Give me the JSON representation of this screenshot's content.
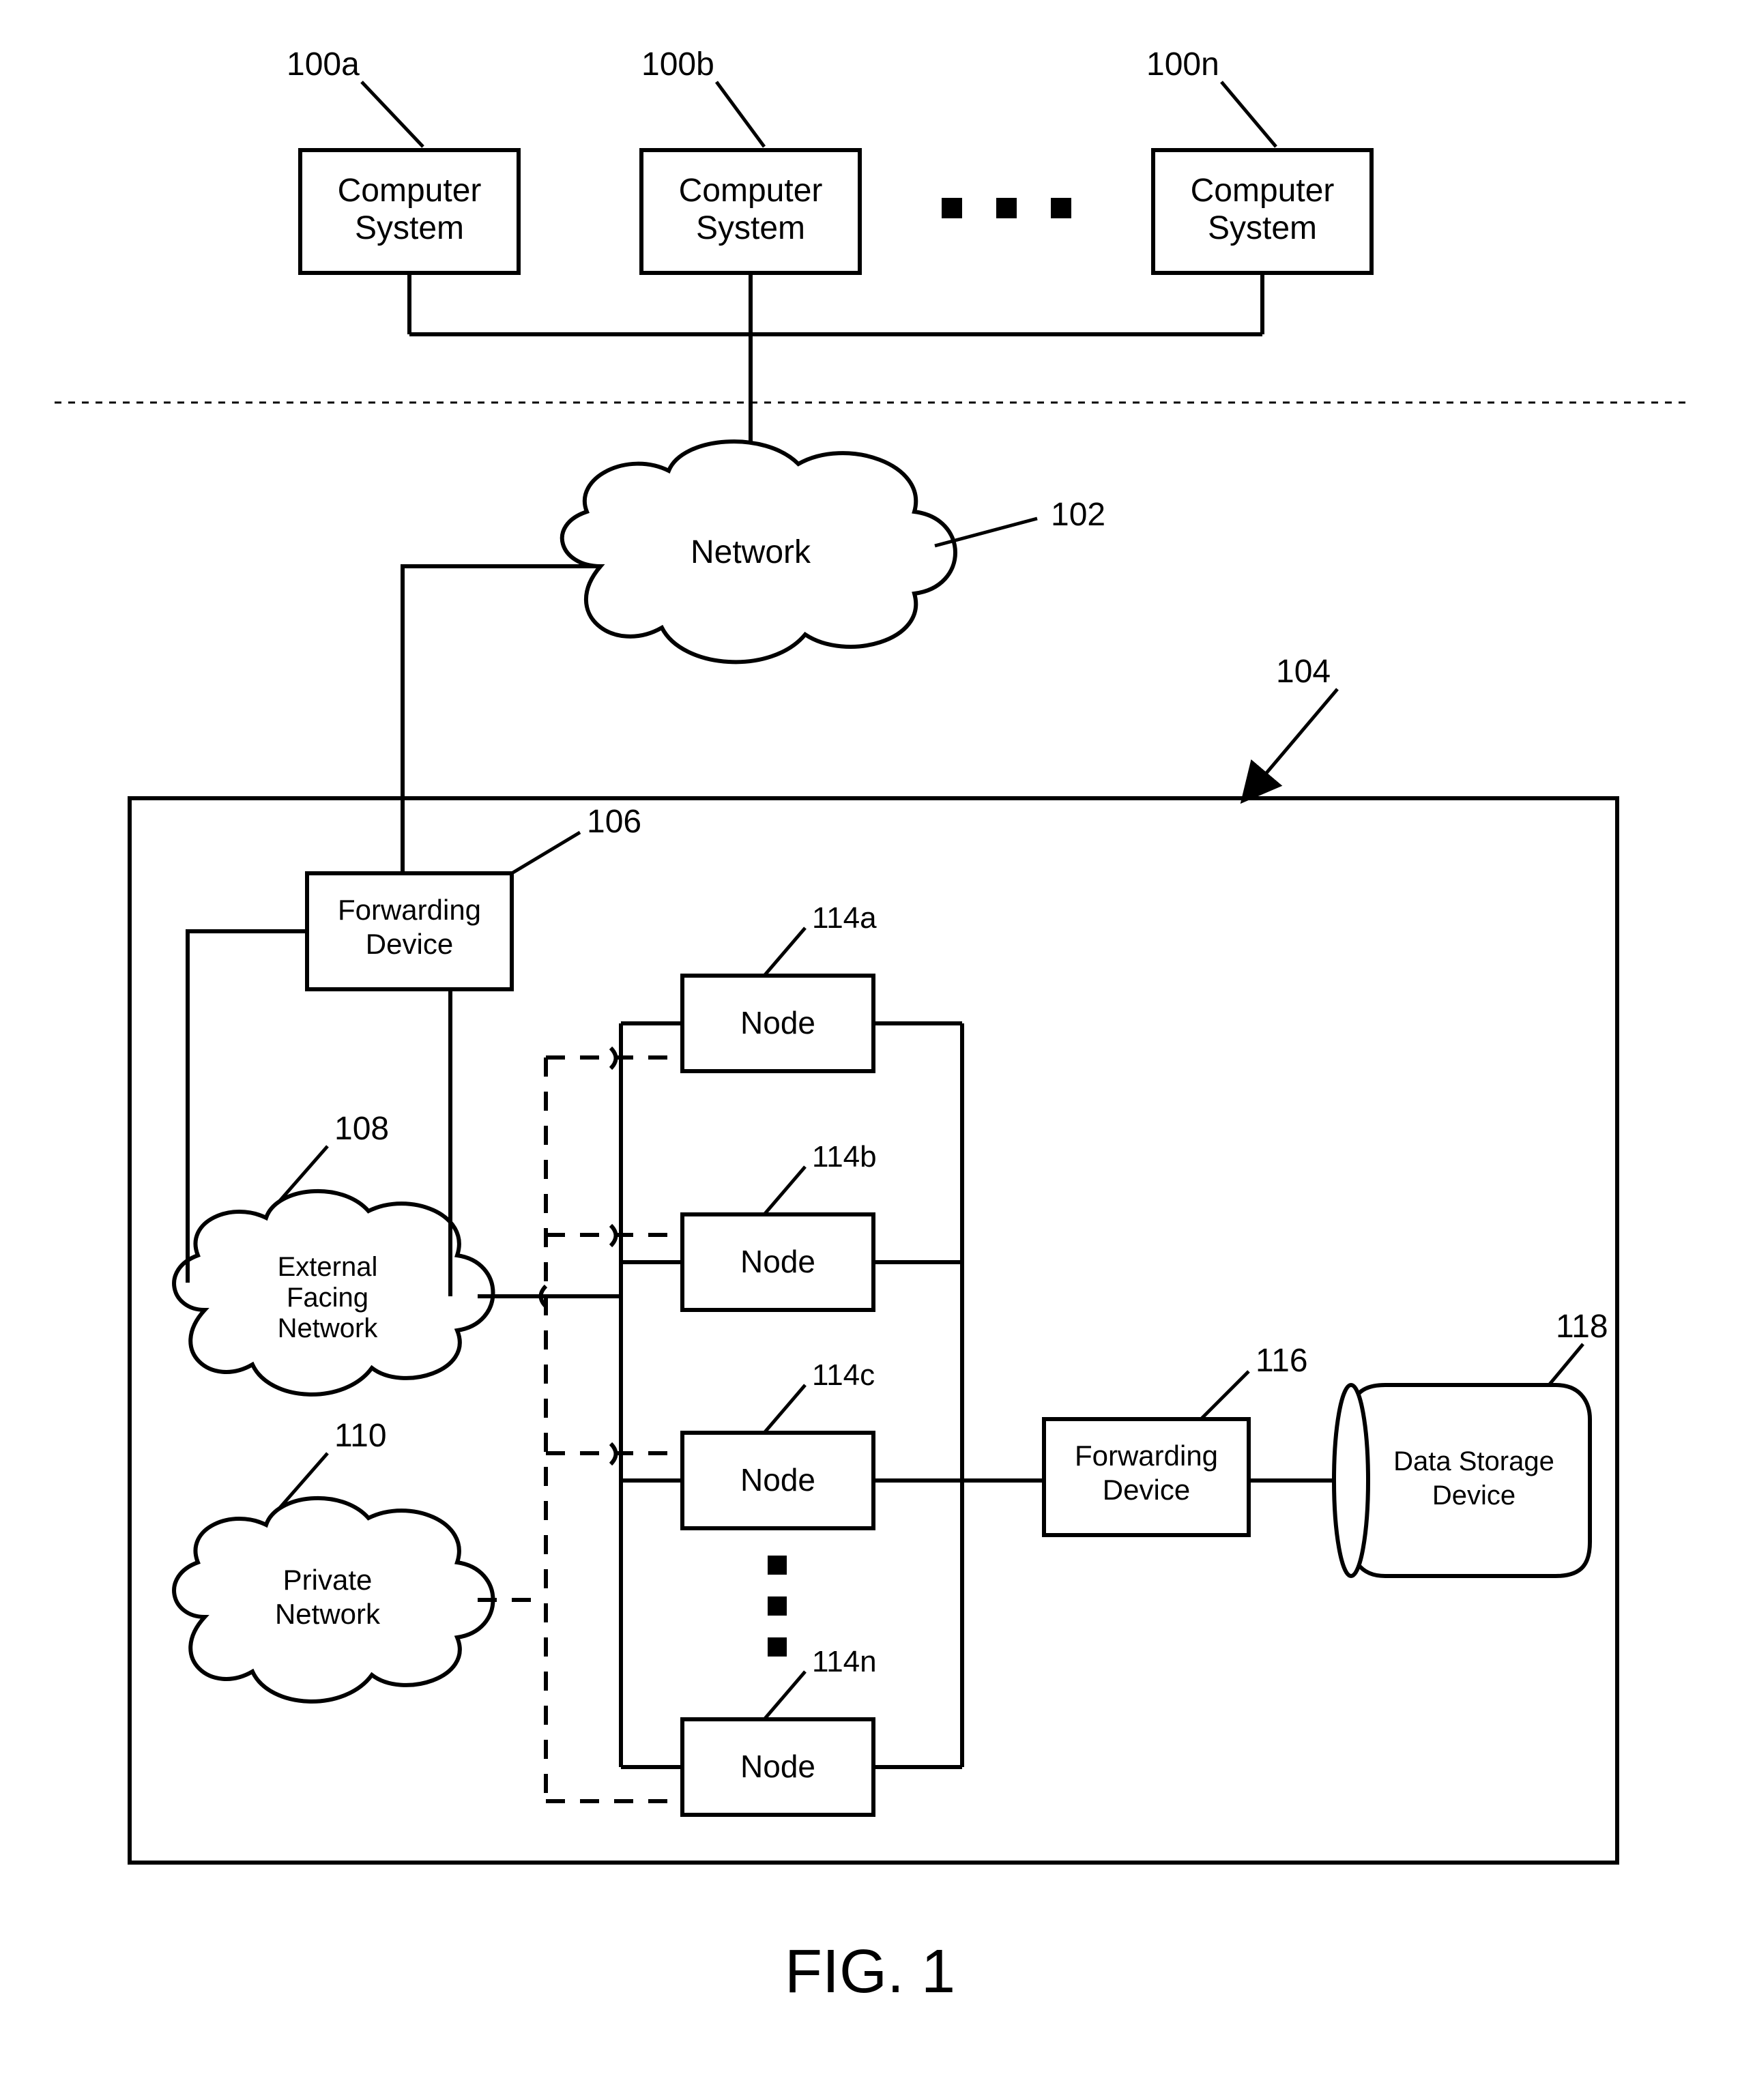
{
  "figure_title": "FIG. 1",
  "refs": {
    "ref_100a": "100a",
    "ref_100b": "100b",
    "ref_100n": "100n",
    "ref_102": "102",
    "ref_104": "104",
    "ref_106": "106",
    "ref_108": "108",
    "ref_110": "110",
    "ref_114a": "114a",
    "ref_114b": "114b",
    "ref_114c": "114c",
    "ref_114n": "114n",
    "ref_116": "116",
    "ref_118": "118"
  },
  "labels": {
    "computer_system_l1": "Computer",
    "computer_system_l2": "System",
    "network": "Network",
    "forwarding_l1": "Forwarding",
    "forwarding_l2": "Device",
    "ext_l1": "External",
    "ext_l2": "Facing",
    "ext_l3": "Network",
    "priv_l1": "Private",
    "priv_l2": "Network",
    "node": "Node",
    "storage_l1": "Data Storage",
    "storage_l2": "Device"
  }
}
